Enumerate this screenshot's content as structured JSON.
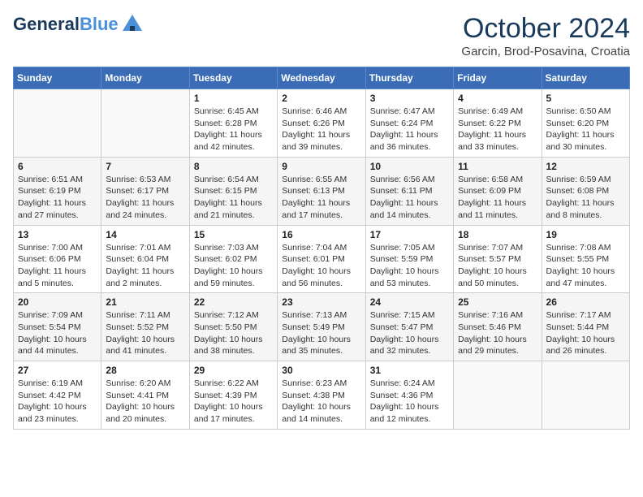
{
  "header": {
    "logo_line1": "General",
    "logo_line2": "Blue",
    "month": "October 2024",
    "location": "Garcin, Brod-Posavina, Croatia"
  },
  "weekdays": [
    "Sunday",
    "Monday",
    "Tuesday",
    "Wednesday",
    "Thursday",
    "Friday",
    "Saturday"
  ],
  "weeks": [
    [
      {
        "day": "",
        "sunrise": "",
        "sunset": "",
        "daylight": ""
      },
      {
        "day": "",
        "sunrise": "",
        "sunset": "",
        "daylight": ""
      },
      {
        "day": "1",
        "sunrise": "Sunrise: 6:45 AM",
        "sunset": "Sunset: 6:28 PM",
        "daylight": "Daylight: 11 hours and 42 minutes."
      },
      {
        "day": "2",
        "sunrise": "Sunrise: 6:46 AM",
        "sunset": "Sunset: 6:26 PM",
        "daylight": "Daylight: 11 hours and 39 minutes."
      },
      {
        "day": "3",
        "sunrise": "Sunrise: 6:47 AM",
        "sunset": "Sunset: 6:24 PM",
        "daylight": "Daylight: 11 hours and 36 minutes."
      },
      {
        "day": "4",
        "sunrise": "Sunrise: 6:49 AM",
        "sunset": "Sunset: 6:22 PM",
        "daylight": "Daylight: 11 hours and 33 minutes."
      },
      {
        "day": "5",
        "sunrise": "Sunrise: 6:50 AM",
        "sunset": "Sunset: 6:20 PM",
        "daylight": "Daylight: 11 hours and 30 minutes."
      }
    ],
    [
      {
        "day": "6",
        "sunrise": "Sunrise: 6:51 AM",
        "sunset": "Sunset: 6:19 PM",
        "daylight": "Daylight: 11 hours and 27 minutes."
      },
      {
        "day": "7",
        "sunrise": "Sunrise: 6:53 AM",
        "sunset": "Sunset: 6:17 PM",
        "daylight": "Daylight: 11 hours and 24 minutes."
      },
      {
        "day": "8",
        "sunrise": "Sunrise: 6:54 AM",
        "sunset": "Sunset: 6:15 PM",
        "daylight": "Daylight: 11 hours and 21 minutes."
      },
      {
        "day": "9",
        "sunrise": "Sunrise: 6:55 AM",
        "sunset": "Sunset: 6:13 PM",
        "daylight": "Daylight: 11 hours and 17 minutes."
      },
      {
        "day": "10",
        "sunrise": "Sunrise: 6:56 AM",
        "sunset": "Sunset: 6:11 PM",
        "daylight": "Daylight: 11 hours and 14 minutes."
      },
      {
        "day": "11",
        "sunrise": "Sunrise: 6:58 AM",
        "sunset": "Sunset: 6:09 PM",
        "daylight": "Daylight: 11 hours and 11 minutes."
      },
      {
        "day": "12",
        "sunrise": "Sunrise: 6:59 AM",
        "sunset": "Sunset: 6:08 PM",
        "daylight": "Daylight: 11 hours and 8 minutes."
      }
    ],
    [
      {
        "day": "13",
        "sunrise": "Sunrise: 7:00 AM",
        "sunset": "Sunset: 6:06 PM",
        "daylight": "Daylight: 11 hours and 5 minutes."
      },
      {
        "day": "14",
        "sunrise": "Sunrise: 7:01 AM",
        "sunset": "Sunset: 6:04 PM",
        "daylight": "Daylight: 11 hours and 2 minutes."
      },
      {
        "day": "15",
        "sunrise": "Sunrise: 7:03 AM",
        "sunset": "Sunset: 6:02 PM",
        "daylight": "Daylight: 10 hours and 59 minutes."
      },
      {
        "day": "16",
        "sunrise": "Sunrise: 7:04 AM",
        "sunset": "Sunset: 6:01 PM",
        "daylight": "Daylight: 10 hours and 56 minutes."
      },
      {
        "day": "17",
        "sunrise": "Sunrise: 7:05 AM",
        "sunset": "Sunset: 5:59 PM",
        "daylight": "Daylight: 10 hours and 53 minutes."
      },
      {
        "day": "18",
        "sunrise": "Sunrise: 7:07 AM",
        "sunset": "Sunset: 5:57 PM",
        "daylight": "Daylight: 10 hours and 50 minutes."
      },
      {
        "day": "19",
        "sunrise": "Sunrise: 7:08 AM",
        "sunset": "Sunset: 5:55 PM",
        "daylight": "Daylight: 10 hours and 47 minutes."
      }
    ],
    [
      {
        "day": "20",
        "sunrise": "Sunrise: 7:09 AM",
        "sunset": "Sunset: 5:54 PM",
        "daylight": "Daylight: 10 hours and 44 minutes."
      },
      {
        "day": "21",
        "sunrise": "Sunrise: 7:11 AM",
        "sunset": "Sunset: 5:52 PM",
        "daylight": "Daylight: 10 hours and 41 minutes."
      },
      {
        "day": "22",
        "sunrise": "Sunrise: 7:12 AM",
        "sunset": "Sunset: 5:50 PM",
        "daylight": "Daylight: 10 hours and 38 minutes."
      },
      {
        "day": "23",
        "sunrise": "Sunrise: 7:13 AM",
        "sunset": "Sunset: 5:49 PM",
        "daylight": "Daylight: 10 hours and 35 minutes."
      },
      {
        "day": "24",
        "sunrise": "Sunrise: 7:15 AM",
        "sunset": "Sunset: 5:47 PM",
        "daylight": "Daylight: 10 hours and 32 minutes."
      },
      {
        "day": "25",
        "sunrise": "Sunrise: 7:16 AM",
        "sunset": "Sunset: 5:46 PM",
        "daylight": "Daylight: 10 hours and 29 minutes."
      },
      {
        "day": "26",
        "sunrise": "Sunrise: 7:17 AM",
        "sunset": "Sunset: 5:44 PM",
        "daylight": "Daylight: 10 hours and 26 minutes."
      }
    ],
    [
      {
        "day": "27",
        "sunrise": "Sunrise: 6:19 AM",
        "sunset": "Sunset: 4:42 PM",
        "daylight": "Daylight: 10 hours and 23 minutes."
      },
      {
        "day": "28",
        "sunrise": "Sunrise: 6:20 AM",
        "sunset": "Sunset: 4:41 PM",
        "daylight": "Daylight: 10 hours and 20 minutes."
      },
      {
        "day": "29",
        "sunrise": "Sunrise: 6:22 AM",
        "sunset": "Sunset: 4:39 PM",
        "daylight": "Daylight: 10 hours and 17 minutes."
      },
      {
        "day": "30",
        "sunrise": "Sunrise: 6:23 AM",
        "sunset": "Sunset: 4:38 PM",
        "daylight": "Daylight: 10 hours and 14 minutes."
      },
      {
        "day": "31",
        "sunrise": "Sunrise: 6:24 AM",
        "sunset": "Sunset: 4:36 PM",
        "daylight": "Daylight: 10 hours and 12 minutes."
      },
      {
        "day": "",
        "sunrise": "",
        "sunset": "",
        "daylight": ""
      },
      {
        "day": "",
        "sunrise": "",
        "sunset": "",
        "daylight": ""
      }
    ]
  ]
}
